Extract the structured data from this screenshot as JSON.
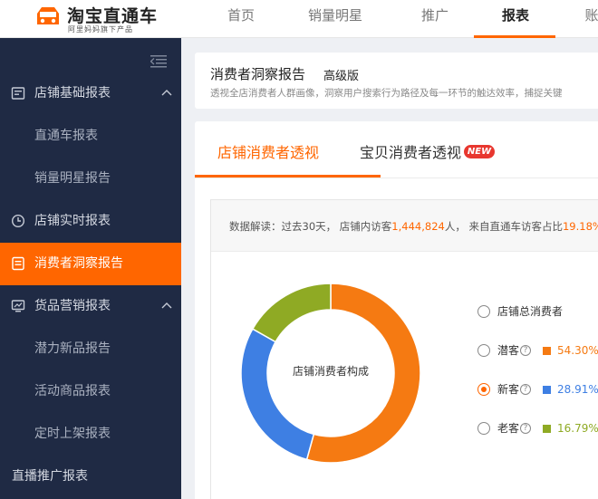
{
  "app": {
    "logo_title": "淘宝直通车",
    "logo_sub": "阿里妈妈旗下产品"
  },
  "nav": {
    "items": [
      "首页",
      "销量明星",
      "推广",
      "报表",
      "账"
    ],
    "active_index": 3
  },
  "sidebar": {
    "items": [
      {
        "label": "店铺基础报表",
        "type": "group",
        "icon": "report-icon",
        "expanded": true
      },
      {
        "label": "直通车报表",
        "type": "sub"
      },
      {
        "label": "销量明星报告",
        "type": "sub"
      },
      {
        "label": "店铺实时报表",
        "type": "group",
        "icon": "clock-icon"
      },
      {
        "label": "消费者洞察报告",
        "type": "group",
        "icon": "document-icon",
        "active": true
      },
      {
        "label": "货品营销报表",
        "type": "group",
        "icon": "monitor-icon",
        "expanded": true
      },
      {
        "label": "潜力新品报告",
        "type": "sub"
      },
      {
        "label": "活动商品报表",
        "type": "sub"
      },
      {
        "label": "定时上架报表",
        "type": "sub"
      },
      {
        "label": "直播推广报表",
        "type": "top"
      }
    ]
  },
  "header": {
    "title": "消费者洞察报告",
    "badge": "高级版",
    "description": "透视全店消费者人群画像，洞察用户搜索行为路径及每一环节的触达效率，捕捉关键"
  },
  "tabs": [
    {
      "label": "店铺消费者透视",
      "active": true
    },
    {
      "label": "宝贝消费者透视",
      "active": false,
      "badge": "NEW"
    }
  ],
  "interpretation": {
    "prefix": "数据解读：过去30天，  店铺内访客",
    "visitors": "1,444,824",
    "mid": "人，  来自直通车访客占比",
    "ratio": "19.18%"
  },
  "donut": {
    "center_label": "店铺消费者构成"
  },
  "chart_data": {
    "type": "pie",
    "series": [
      {
        "name": "潜客",
        "value": 54.3,
        "label": "54.30%",
        "color": "#f57a12"
      },
      {
        "name": "新客",
        "value": 28.91,
        "label": "28.91%",
        "color": "#3e7fe3"
      },
      {
        "name": "老客",
        "value": 16.79,
        "label": "16.79%",
        "color": "#8faa24"
      }
    ]
  },
  "legend": {
    "total_label": "店铺总消费者",
    "selected": "新客",
    "help_glyph": "?"
  },
  "colors": {
    "accent": "#ff6600",
    "sidebar_bg": "#1f2a44"
  }
}
